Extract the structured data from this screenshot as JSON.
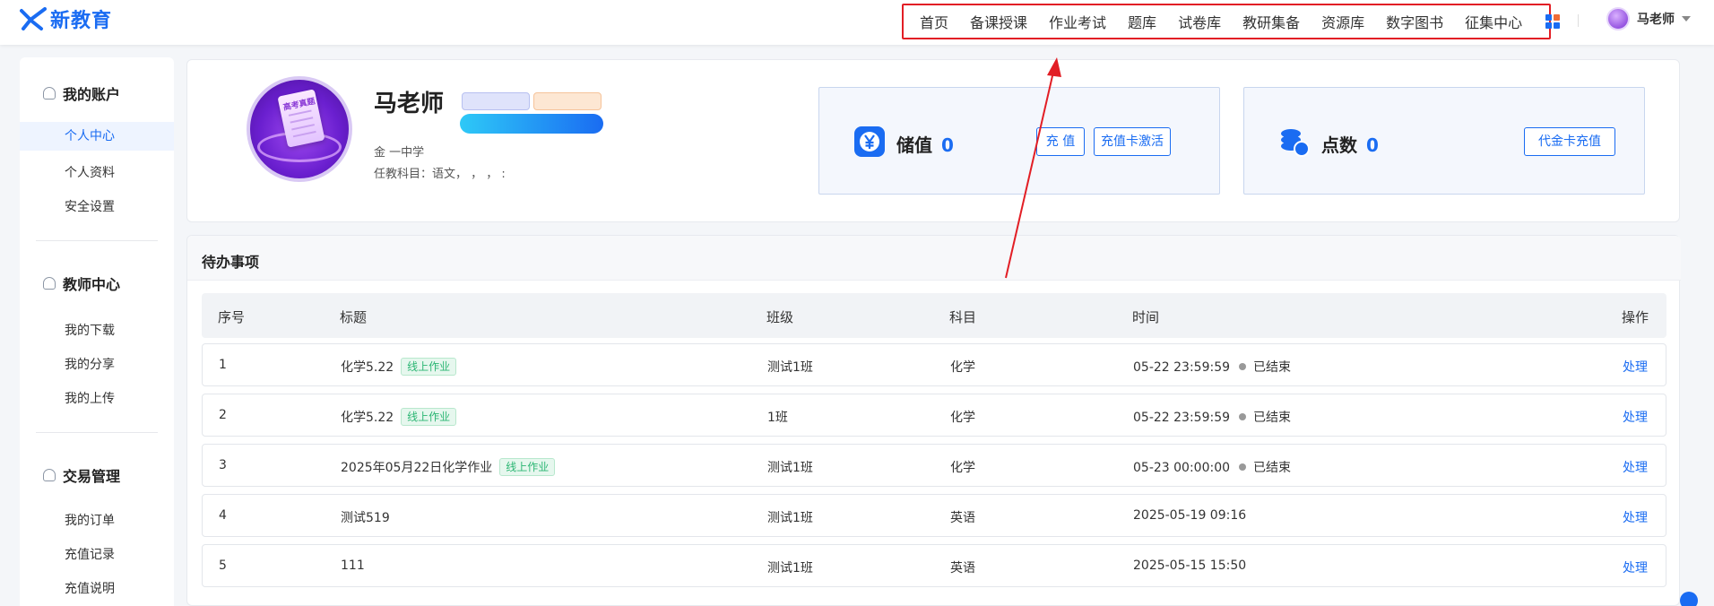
{
  "brand": {
    "logo_text": "新教育",
    "accent": "#1a6cf2",
    "annotation": "#e21e25"
  },
  "nav": {
    "items": [
      "首页",
      "备课授课",
      "作业考试",
      "题库",
      "试卷库",
      "教研集备",
      "资源库",
      "数字图书",
      "征集中心"
    ],
    "grid_icon": "apps-grid-icon"
  },
  "user": {
    "name": "马老师"
  },
  "sidebar": {
    "groups": [
      {
        "title": "我的账户",
        "icon": "user-icon",
        "items": [
          "个人中心",
          "个人资料",
          "安全设置"
        ]
      },
      {
        "title": "教师中心",
        "icon": "teacher-icon",
        "items": [
          "我的下载",
          "我的分享",
          "我的上传"
        ]
      },
      {
        "title": "交易管理",
        "icon": "trade-icon",
        "items": [
          "我的订单",
          "充值记录",
          "充值说明"
        ]
      }
    ],
    "active_item": "个人中心"
  },
  "profile": {
    "name": "马老师",
    "avatar_text": "高考真题",
    "school": "金 一中学",
    "subjects": "任教科目：语文， ， ， :"
  },
  "wallet": {
    "stored": {
      "label": "储值",
      "value": "0",
      "btn_recharge": "充 值",
      "btn_card": "充值卡激活",
      "icon": "yen-icon"
    },
    "points": {
      "label": "点数",
      "value": "0",
      "btn_voucher": "代金卡充值",
      "icon": "coins-icon"
    }
  },
  "todo": {
    "title": "待办事项",
    "columns": [
      "序号",
      "标题",
      "班级",
      "科目",
      "时间",
      "操作"
    ],
    "rows": [
      {
        "no": "1",
        "title": "化学5.22",
        "tag": "线上作业",
        "class": "测试1班",
        "subject": "化学",
        "time": "05-22 23:59:59",
        "status": "已结束",
        "action": "处理"
      },
      {
        "no": "2",
        "title": "化学5.22",
        "tag": "线上作业",
        "class": "1班",
        "subject": "化学",
        "time": "05-22 23:59:59",
        "status": "已结束",
        "action": "处理"
      },
      {
        "no": "3",
        "title": "2025年05月22日化学作业",
        "tag": "线上作业",
        "class": "测试1班",
        "subject": "化学",
        "time": "05-23 00:00:00",
        "status": "已结束",
        "action": "处理"
      },
      {
        "no": "4",
        "title": "测试519",
        "tag": "",
        "class": "测试1班",
        "subject": "英语",
        "time": "2025-05-19 09:16",
        "status": "",
        "action": "处理"
      },
      {
        "no": "5",
        "title": "111",
        "tag": "",
        "class": "测试1班",
        "subject": "英语",
        "time": "2025-05-15 15:50",
        "status": "",
        "action": "处理"
      }
    ]
  }
}
